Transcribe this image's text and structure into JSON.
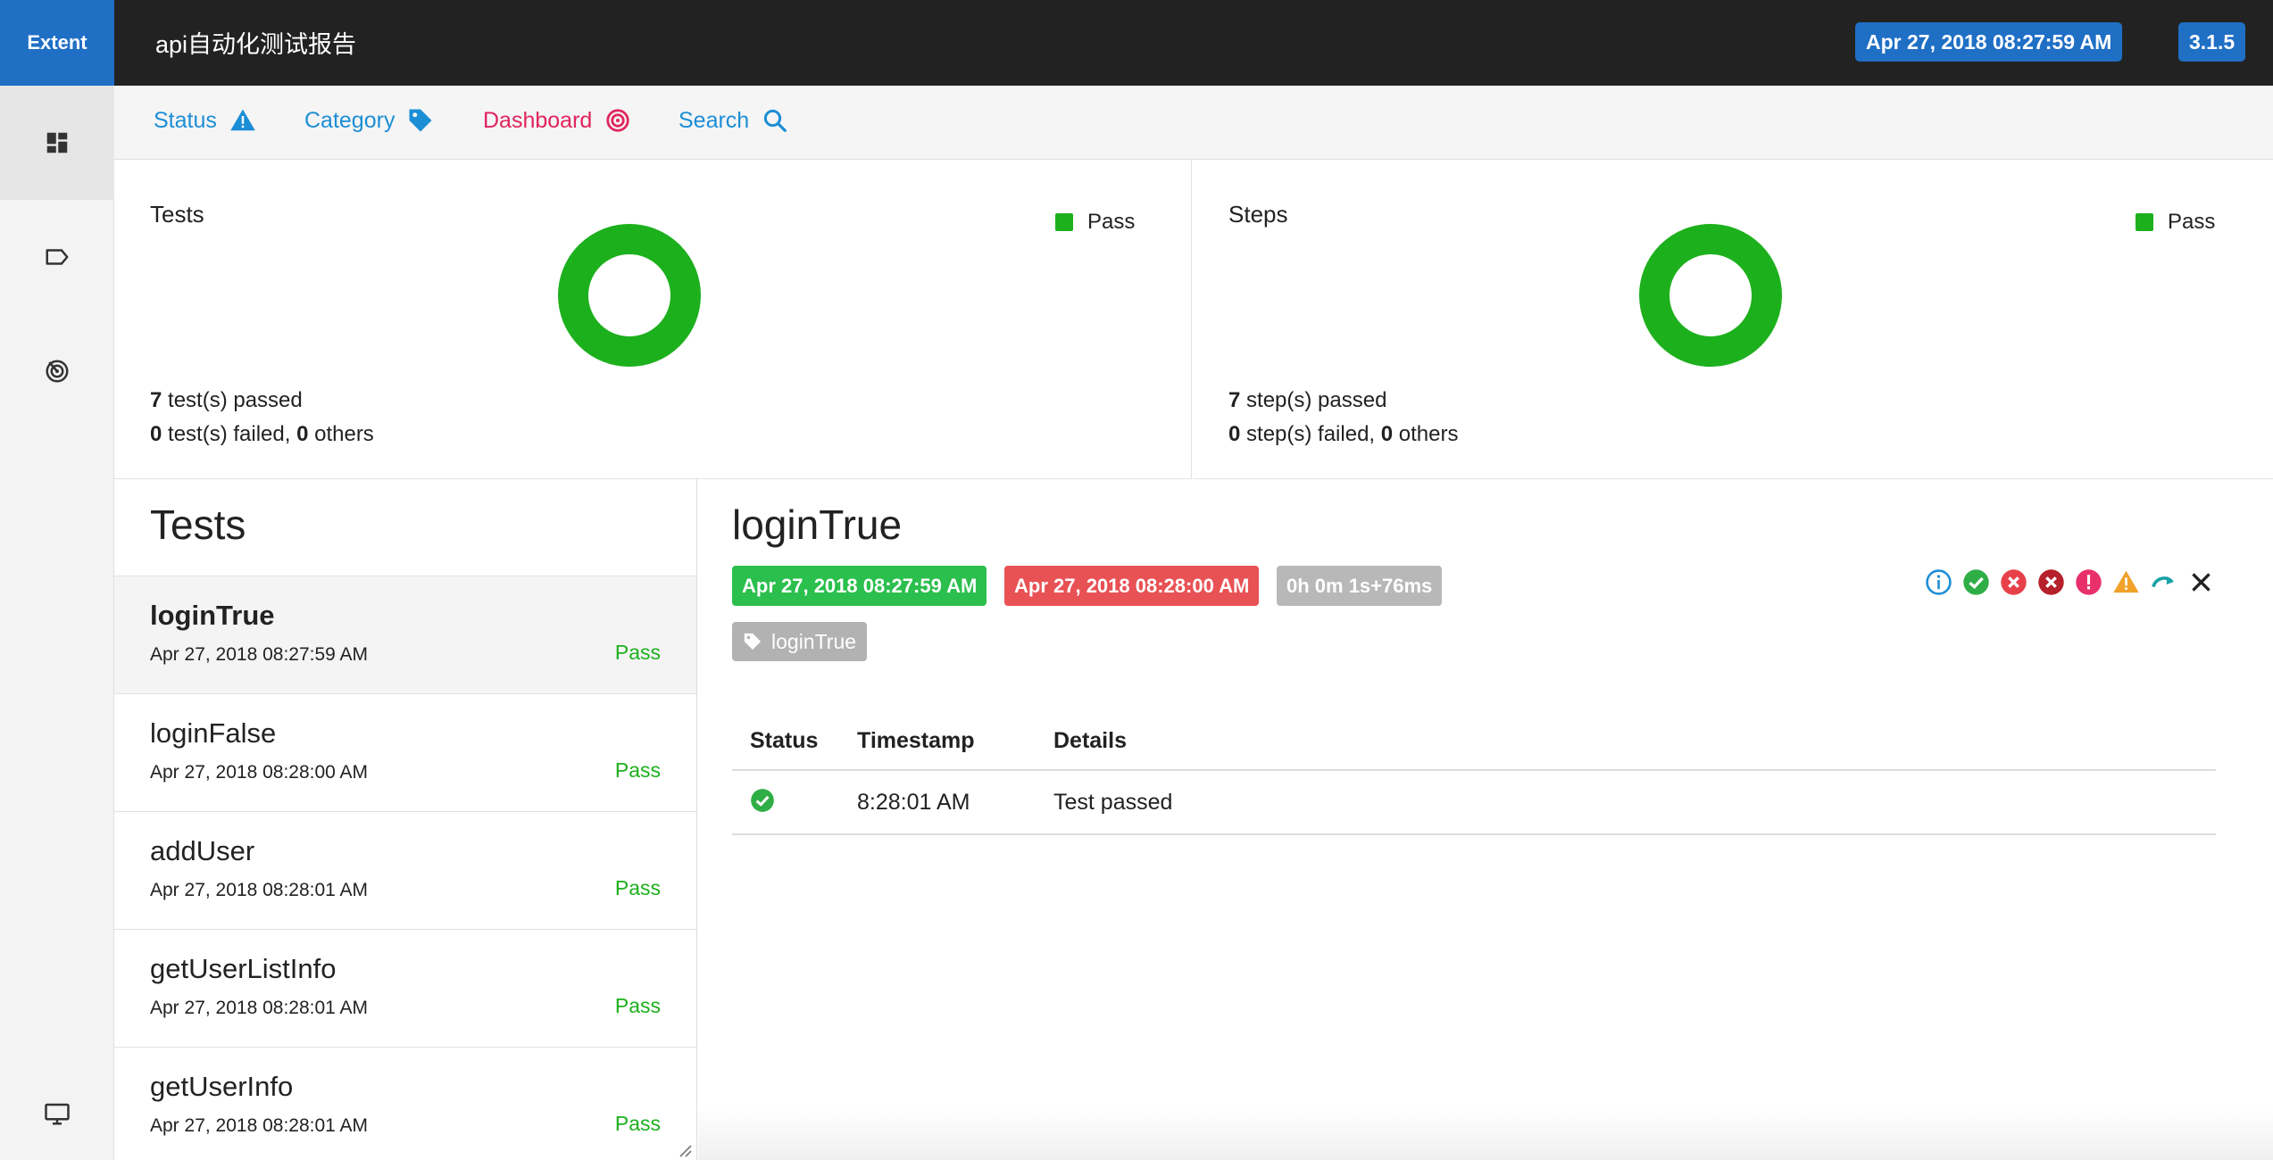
{
  "topbar": {
    "brand": "Extent",
    "title": "api自动化测试报告",
    "date": "Apr 27, 2018 08:27:59 AM",
    "version": "3.1.5"
  },
  "sidebar": {
    "items": [
      {
        "icon": "dashboard-grid-icon",
        "active": true
      },
      {
        "icon": "tag-outline-icon",
        "active": false
      },
      {
        "icon": "radar-icon",
        "active": false
      },
      {
        "icon": "monitor-icon",
        "active": false
      }
    ]
  },
  "nav": {
    "status": "Status",
    "category": "Category",
    "dashboard": "Dashboard",
    "search": "Search"
  },
  "stats": {
    "tests": {
      "title": "Tests",
      "legend": "Pass",
      "passed_count": "7",
      "passed_label": " test(s) passed",
      "failed_count": "0",
      "failed_label": " test(s) failed, ",
      "others_count": "0",
      "others_label": " others"
    },
    "steps": {
      "title": "Steps",
      "legend": "Pass",
      "passed_count": "7",
      "passed_label": " step(s) passed",
      "failed_count": "0",
      "failed_label": " step(s) failed, ",
      "others_count": "0",
      "others_label": " others"
    },
    "pass_color": "#1db01d"
  },
  "tests_list": {
    "heading": "Tests",
    "items": [
      {
        "name": "loginTrue",
        "time": "Apr 27, 2018 08:27:59 AM",
        "status": "Pass"
      },
      {
        "name": "loginFalse",
        "time": "Apr 27, 2018 08:28:00 AM",
        "status": "Pass"
      },
      {
        "name": "addUser",
        "time": "Apr 27, 2018 08:28:01 AM",
        "status": "Pass"
      },
      {
        "name": "getUserListInfo",
        "time": "Apr 27, 2018 08:28:01 AM",
        "status": "Pass"
      },
      {
        "name": "getUserInfo",
        "time": "Apr 27, 2018 08:28:01 AM",
        "status": "Pass"
      }
    ]
  },
  "detail": {
    "title": "loginTrue",
    "start": "Apr 27, 2018 08:27:59 AM",
    "end": "Apr 27, 2018 08:28:00 AM",
    "duration": "0h 0m 1s+76ms",
    "tag": "loginTrue",
    "filter_icons": [
      "info-icon",
      "pass-icon",
      "fail-icon",
      "fatal-icon",
      "error-icon",
      "warning-icon",
      "skip-icon",
      "clear-icon"
    ],
    "table": {
      "headers": [
        "Status",
        "Timestamp",
        "Details"
      ],
      "rows": [
        {
          "status_icon": "pass-check-icon",
          "timestamp": "8:28:01 AM",
          "details": "Test passed"
        }
      ]
    }
  }
}
